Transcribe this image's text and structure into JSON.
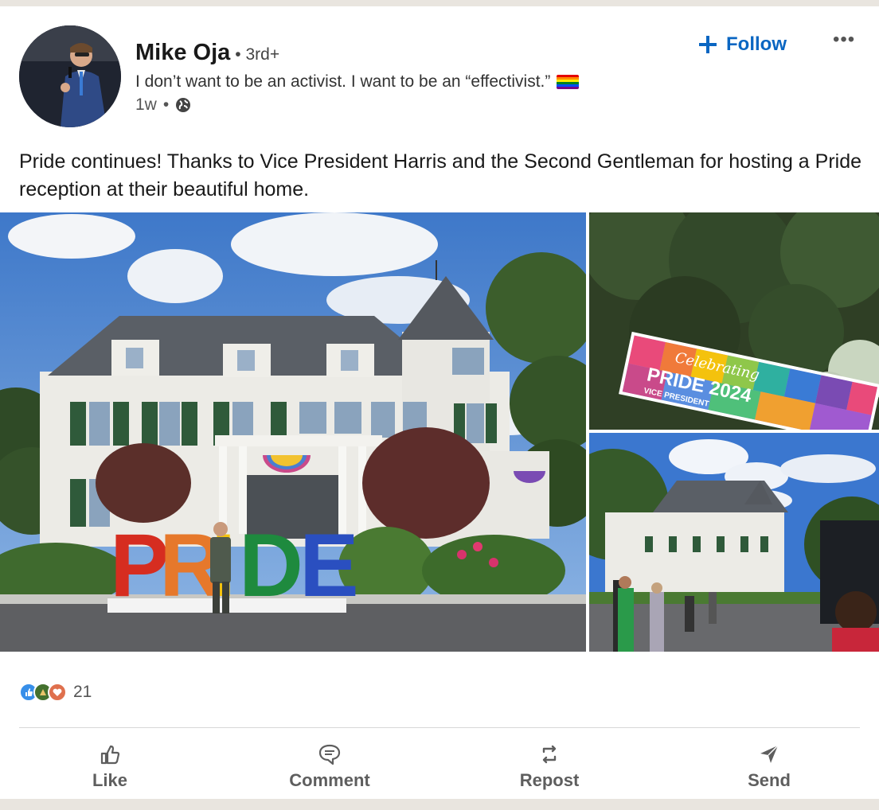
{
  "author": {
    "name": "Mike Oja",
    "degree": "• 3rd+",
    "headline": "I don’t want to be an activist. I want to be an “effectivist.”",
    "time": "1w",
    "dot": "•"
  },
  "header_actions": {
    "follow_label": "Follow",
    "more_label": "•••"
  },
  "post": {
    "text": "Pride continues! Thanks to Vice President Harris and the Second Gentleman for hosting a Pride reception at their beautiful home."
  },
  "images": {
    "sign_script": "Celebrating",
    "sign_title": "PRIDE 2024",
    "sign_sub": "VICE PRESIDENT",
    "letters": [
      "P",
      "R",
      "I",
      "D",
      "E"
    ]
  },
  "social": {
    "reaction_count": "21"
  },
  "actions": [
    {
      "label": "Like",
      "icon": "thumbs-up-icon"
    },
    {
      "label": "Comment",
      "icon": "comment-icon"
    },
    {
      "label": "Repost",
      "icon": "repost-icon"
    },
    {
      "label": "Send",
      "icon": "send-icon"
    }
  ],
  "colors": {
    "accent": "#0a66c2",
    "letter_colors": [
      "#d62d20",
      "#e6782b",
      "#f4c20d",
      "#1e8a3e",
      "#2a4fc0"
    ]
  }
}
